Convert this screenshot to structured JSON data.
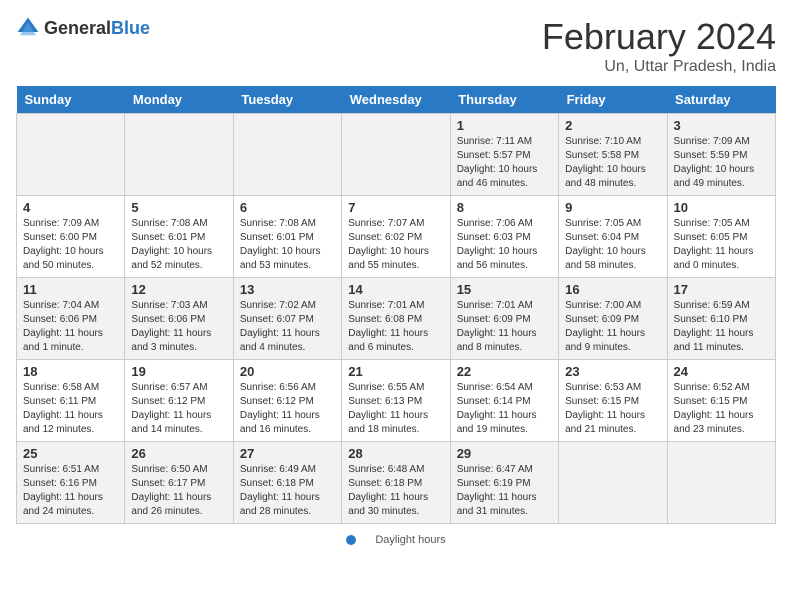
{
  "header": {
    "logo_general": "General",
    "logo_blue": "Blue",
    "month": "February 2024",
    "location": "Un, Uttar Pradesh, India"
  },
  "weekdays": [
    "Sunday",
    "Monday",
    "Tuesday",
    "Wednesday",
    "Thursday",
    "Friday",
    "Saturday"
  ],
  "weeks": [
    [
      {
        "day": "",
        "info": ""
      },
      {
        "day": "",
        "info": ""
      },
      {
        "day": "",
        "info": ""
      },
      {
        "day": "",
        "info": ""
      },
      {
        "day": "1",
        "info": "Sunrise: 7:11 AM\nSunset: 5:57 PM\nDaylight: 10 hours\nand 46 minutes."
      },
      {
        "day": "2",
        "info": "Sunrise: 7:10 AM\nSunset: 5:58 PM\nDaylight: 10 hours\nand 48 minutes."
      },
      {
        "day": "3",
        "info": "Sunrise: 7:09 AM\nSunset: 5:59 PM\nDaylight: 10 hours\nand 49 minutes."
      }
    ],
    [
      {
        "day": "4",
        "info": "Sunrise: 7:09 AM\nSunset: 6:00 PM\nDaylight: 10 hours\nand 50 minutes."
      },
      {
        "day": "5",
        "info": "Sunrise: 7:08 AM\nSunset: 6:01 PM\nDaylight: 10 hours\nand 52 minutes."
      },
      {
        "day": "6",
        "info": "Sunrise: 7:08 AM\nSunset: 6:01 PM\nDaylight: 10 hours\nand 53 minutes."
      },
      {
        "day": "7",
        "info": "Sunrise: 7:07 AM\nSunset: 6:02 PM\nDaylight: 10 hours\nand 55 minutes."
      },
      {
        "day": "8",
        "info": "Sunrise: 7:06 AM\nSunset: 6:03 PM\nDaylight: 10 hours\nand 56 minutes."
      },
      {
        "day": "9",
        "info": "Sunrise: 7:05 AM\nSunset: 6:04 PM\nDaylight: 10 hours\nand 58 minutes."
      },
      {
        "day": "10",
        "info": "Sunrise: 7:05 AM\nSunset: 6:05 PM\nDaylight: 11 hours\nand 0 minutes."
      }
    ],
    [
      {
        "day": "11",
        "info": "Sunrise: 7:04 AM\nSunset: 6:06 PM\nDaylight: 11 hours\nand 1 minute."
      },
      {
        "day": "12",
        "info": "Sunrise: 7:03 AM\nSunset: 6:06 PM\nDaylight: 11 hours\nand 3 minutes."
      },
      {
        "day": "13",
        "info": "Sunrise: 7:02 AM\nSunset: 6:07 PM\nDaylight: 11 hours\nand 4 minutes."
      },
      {
        "day": "14",
        "info": "Sunrise: 7:01 AM\nSunset: 6:08 PM\nDaylight: 11 hours\nand 6 minutes."
      },
      {
        "day": "15",
        "info": "Sunrise: 7:01 AM\nSunset: 6:09 PM\nDaylight: 11 hours\nand 8 minutes."
      },
      {
        "day": "16",
        "info": "Sunrise: 7:00 AM\nSunset: 6:09 PM\nDaylight: 11 hours\nand 9 minutes."
      },
      {
        "day": "17",
        "info": "Sunrise: 6:59 AM\nSunset: 6:10 PM\nDaylight: 11 hours\nand 11 minutes."
      }
    ],
    [
      {
        "day": "18",
        "info": "Sunrise: 6:58 AM\nSunset: 6:11 PM\nDaylight: 11 hours\nand 12 minutes."
      },
      {
        "day": "19",
        "info": "Sunrise: 6:57 AM\nSunset: 6:12 PM\nDaylight: 11 hours\nand 14 minutes."
      },
      {
        "day": "20",
        "info": "Sunrise: 6:56 AM\nSunset: 6:12 PM\nDaylight: 11 hours\nand 16 minutes."
      },
      {
        "day": "21",
        "info": "Sunrise: 6:55 AM\nSunset: 6:13 PM\nDaylight: 11 hours\nand 18 minutes."
      },
      {
        "day": "22",
        "info": "Sunrise: 6:54 AM\nSunset: 6:14 PM\nDaylight: 11 hours\nand 19 minutes."
      },
      {
        "day": "23",
        "info": "Sunrise: 6:53 AM\nSunset: 6:15 PM\nDaylight: 11 hours\nand 21 minutes."
      },
      {
        "day": "24",
        "info": "Sunrise: 6:52 AM\nSunset: 6:15 PM\nDaylight: 11 hours\nand 23 minutes."
      }
    ],
    [
      {
        "day": "25",
        "info": "Sunrise: 6:51 AM\nSunset: 6:16 PM\nDaylight: 11 hours\nand 24 minutes."
      },
      {
        "day": "26",
        "info": "Sunrise: 6:50 AM\nSunset: 6:17 PM\nDaylight: 11 hours\nand 26 minutes."
      },
      {
        "day": "27",
        "info": "Sunrise: 6:49 AM\nSunset: 6:18 PM\nDaylight: 11 hours\nand 28 minutes."
      },
      {
        "day": "28",
        "info": "Sunrise: 6:48 AM\nSunset: 6:18 PM\nDaylight: 11 hours\nand 30 minutes."
      },
      {
        "day": "29",
        "info": "Sunrise: 6:47 AM\nSunset: 6:19 PM\nDaylight: 11 hours\nand 31 minutes."
      },
      {
        "day": "",
        "info": ""
      },
      {
        "day": "",
        "info": ""
      }
    ]
  ],
  "footer": {
    "daylight_label": "Daylight hours"
  }
}
